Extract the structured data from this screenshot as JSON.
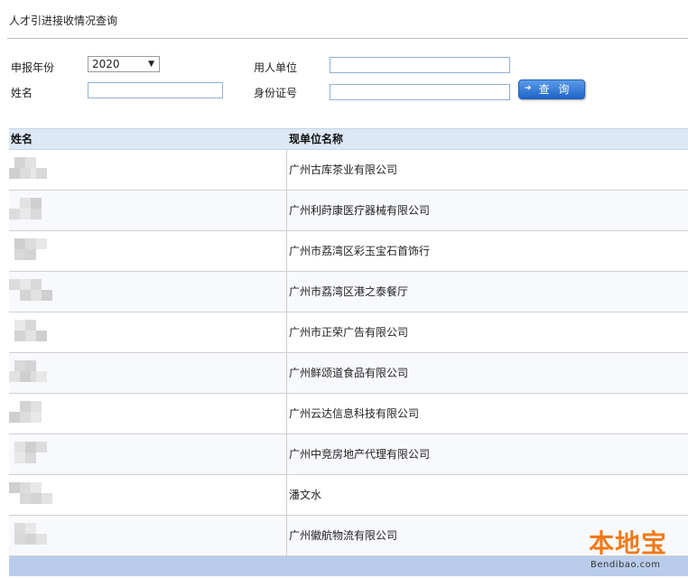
{
  "page_title": "人才引进接收情况查询",
  "form": {
    "year_label": "申报年份",
    "year_value": "2020",
    "employer_label": "用人单位",
    "employer_value": "",
    "name_label": "姓名",
    "name_value": "",
    "id_label": "身份证号",
    "id_value": "",
    "query_button": "查 询"
  },
  "table": {
    "headers": {
      "name": "姓名",
      "company": "现单位名称"
    },
    "rows": [
      {
        "company": "广州古库茶业有限公司"
      },
      {
        "company": "广州利莳康医疗器械有限公司"
      },
      {
        "company": "广州市荔湾区彩玉宝石首饰行"
      },
      {
        "company": "广州市荔湾区港之泰餐厅"
      },
      {
        "company": "广州市正荣广告有限公司"
      },
      {
        "company": "广州鲜颂道食品有限公司"
      },
      {
        "company": "广州云达信息科技有限公司"
      },
      {
        "company": "广州中竞房地产代理有限公司"
      },
      {
        "company": "潘文水"
      },
      {
        "company": "广州徽航物流有限公司"
      }
    ]
  },
  "watermark": {
    "logo": "本地宝",
    "url": "Bendibao.com"
  }
}
